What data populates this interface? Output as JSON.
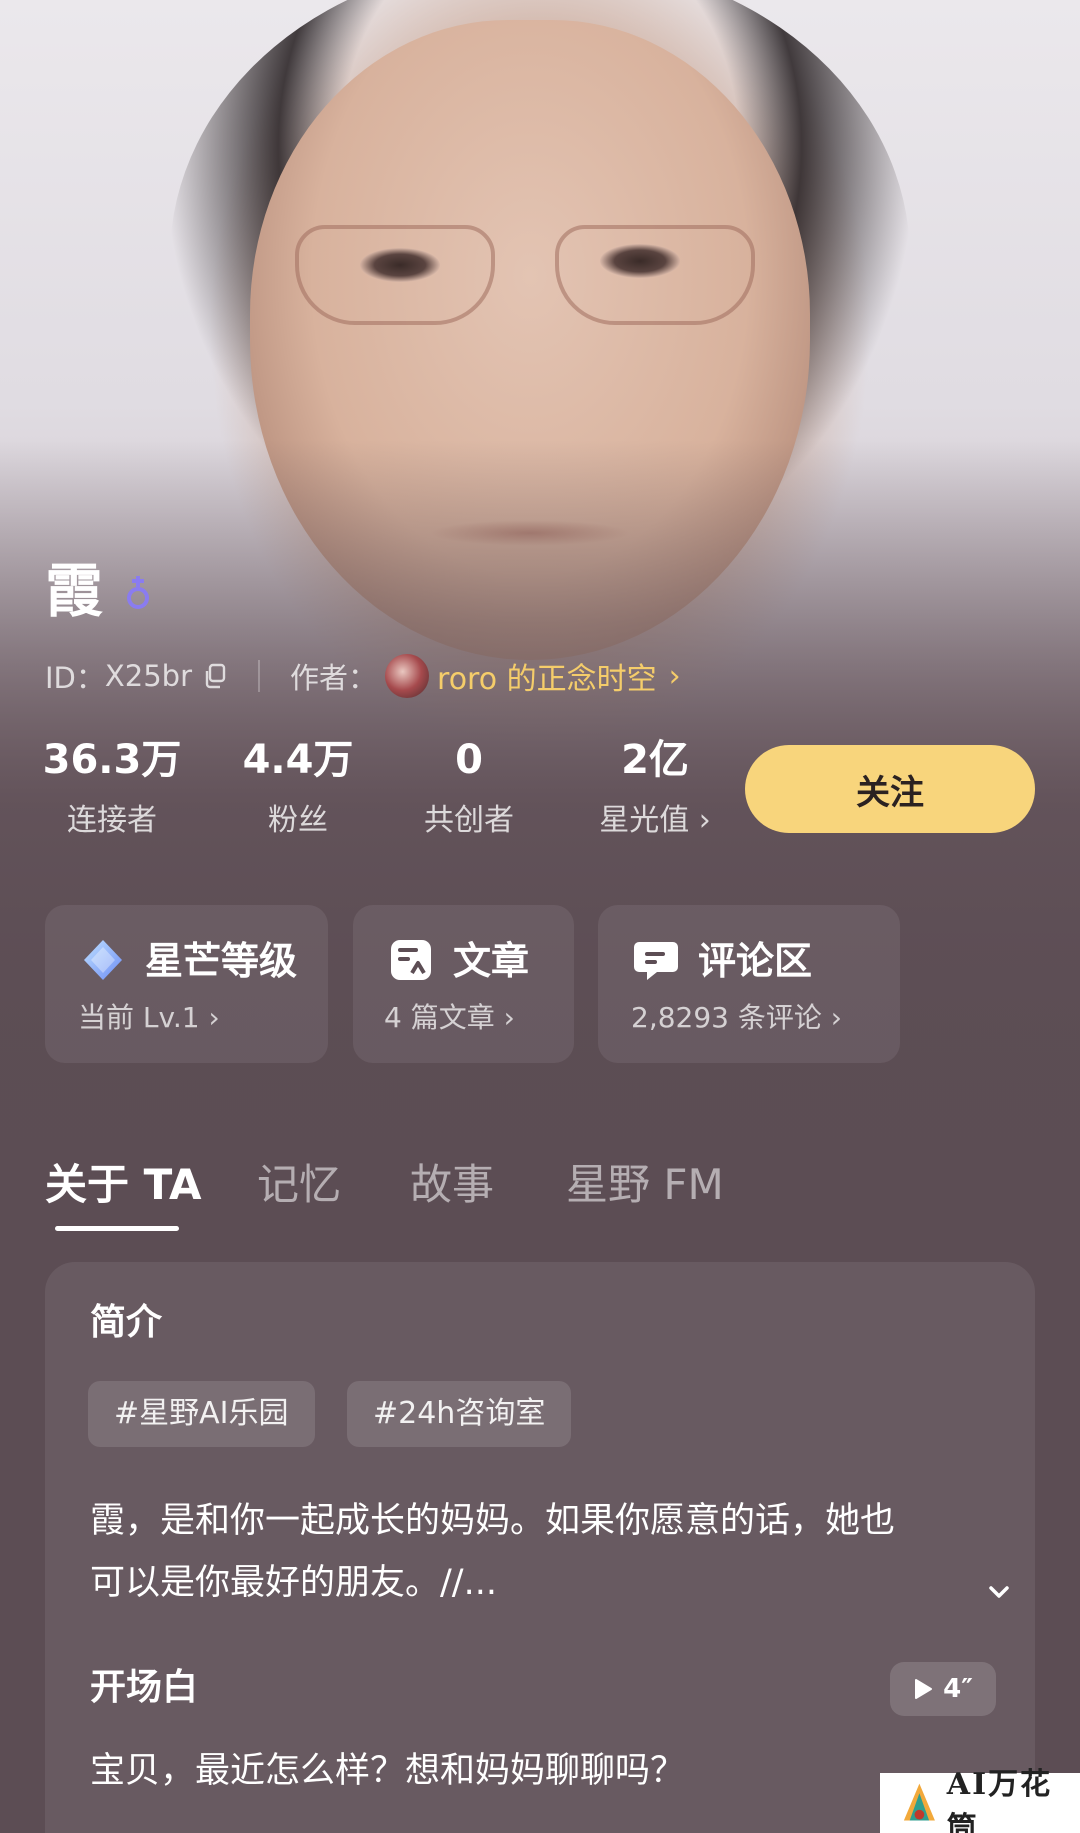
{
  "profile": {
    "name": "霞",
    "id_label": "ID：",
    "id_value": "X25br",
    "author_label": "作者：",
    "author_name": "roro 的正念时空",
    "colors": {
      "accent_gold": "#f8d57c",
      "author_gold": "#f5cd6a",
      "gender_purple": "#8a7cf0"
    }
  },
  "stats": [
    {
      "value": "36.3万",
      "label": "连接者"
    },
    {
      "value": "4.4万",
      "label": "粉丝"
    },
    {
      "value": "0",
      "label": "共创者"
    },
    {
      "value": "2亿",
      "label": "星光值"
    }
  ],
  "follow_button": "关注",
  "cards": [
    {
      "title": "星芒等级",
      "subtitle": "当前 Lv.1",
      "icon": "diamond-icon"
    },
    {
      "title": "文章",
      "subtitle": "4 篇文章",
      "icon": "article-icon"
    },
    {
      "title": "评论区",
      "subtitle": "2,8293 条评论",
      "icon": "comment-icon"
    }
  ],
  "tabs": [
    {
      "label": "关于 TA",
      "active": true
    },
    {
      "label": "记忆",
      "active": false
    },
    {
      "label": "故事",
      "active": false
    },
    {
      "label": "星野 FM",
      "active": false
    }
  ],
  "about": {
    "intro_title": "简介",
    "tags": [
      "#星野AI乐园",
      "#24h咨询室"
    ],
    "intro_line1": "霞，是和你一起成长的妈妈。如果你愿意的话，她也",
    "intro_line2": "可以是你最好的朋友。//...",
    "opening_title": "开场白",
    "audio_duration": "4″",
    "opening_text": "宝贝，最近怎么样？想和妈妈聊聊吗？"
  },
  "watermark": {
    "text": "AI万花筒"
  }
}
